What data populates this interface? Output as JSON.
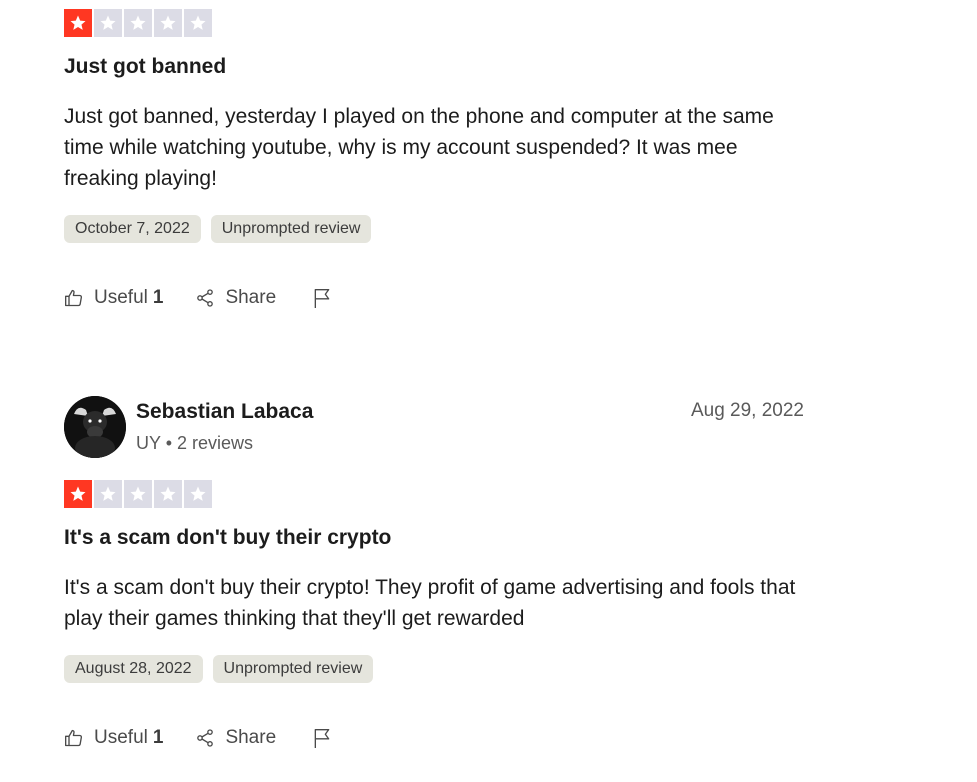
{
  "reviews": [
    {
      "rating": 1,
      "max_rating": 5,
      "title": "Just got banned",
      "body": "Just got banned, yesterday I played on the phone and computer at the same time while watching youtube, why is my account suspended? It was mee freaking playing!",
      "date_tag": "October 7, 2022",
      "type_tag": "Unprompted review",
      "useful_label": "Useful",
      "useful_count": "1",
      "share_label": "Share"
    },
    {
      "reviewer_name": "Sebastian Labaca",
      "reviewer_country": "UY",
      "reviewer_reviews": "2 reviews",
      "posted_date": "Aug 29, 2022",
      "rating": 1,
      "max_rating": 5,
      "title": "It's a scam don't buy their crypto",
      "body": "It's a scam don't buy their crypto! They profit of game advertising and fools that play their games thinking that they'll get rewarded",
      "date_tag": "August 28, 2022",
      "type_tag": "Unprompted review",
      "useful_label": "Useful",
      "useful_count": "1",
      "share_label": "Share"
    }
  ],
  "colors": {
    "star_filled": "#ff3722",
    "star_empty": "#dcdce6",
    "tag_bg": "#e5e5dd"
  },
  "icons": {
    "star": "star-icon",
    "useful": "thumbs-up-icon",
    "share": "share-icon",
    "report": "flag-icon",
    "avatar": "bull-avatar"
  }
}
